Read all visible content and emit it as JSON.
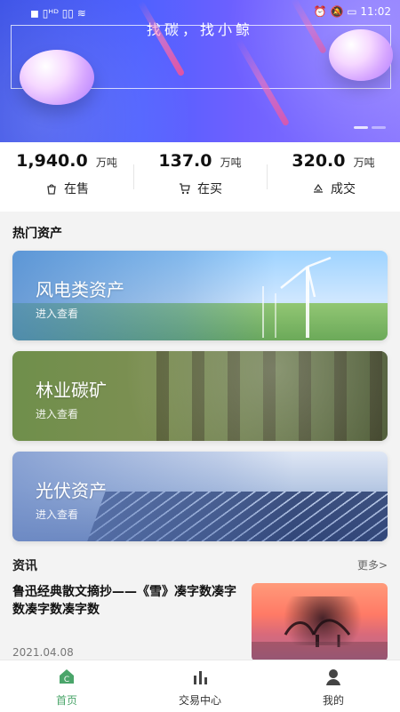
{
  "status_bar": {
    "left": "◼︎  ▯ᴴᴰ  ▯▯  ≋",
    "right": "⏰  🔕  ▭  11:02"
  },
  "banner": {
    "title": "找碳，找小鲸"
  },
  "stats": [
    {
      "value": "1,940.0",
      "unit": "万吨",
      "label": "在售",
      "icon": "bag-icon"
    },
    {
      "value": "137.0",
      "unit": "万吨",
      "label": "在买",
      "icon": "cart-icon"
    },
    {
      "value": "320.0",
      "unit": "万吨",
      "label": "成交",
      "icon": "deal-icon"
    }
  ],
  "hot_assets": {
    "title": "热门资产",
    "items": [
      {
        "title": "风电类资产",
        "subtitle": "进入查看"
      },
      {
        "title": "林业碳矿",
        "subtitle": "进入查看"
      },
      {
        "title": "光伏资产",
        "subtitle": "进入查看"
      }
    ]
  },
  "news": {
    "title": "资讯",
    "more": "更多>",
    "item": {
      "headline": "鲁迅经典散文摘抄——《雪》凑字数凑字数凑字数凑字数",
      "date": "2021.04.08"
    }
  },
  "bottom_nav": [
    {
      "label": "首页",
      "icon": "home-icon",
      "active": true
    },
    {
      "label": "交易中心",
      "icon": "chart-icon",
      "active": false
    },
    {
      "label": "我的",
      "icon": "user-icon",
      "active": false
    }
  ],
  "colors": {
    "accent_green": "#4aa56a",
    "banner_blue": "#4f61ff"
  }
}
